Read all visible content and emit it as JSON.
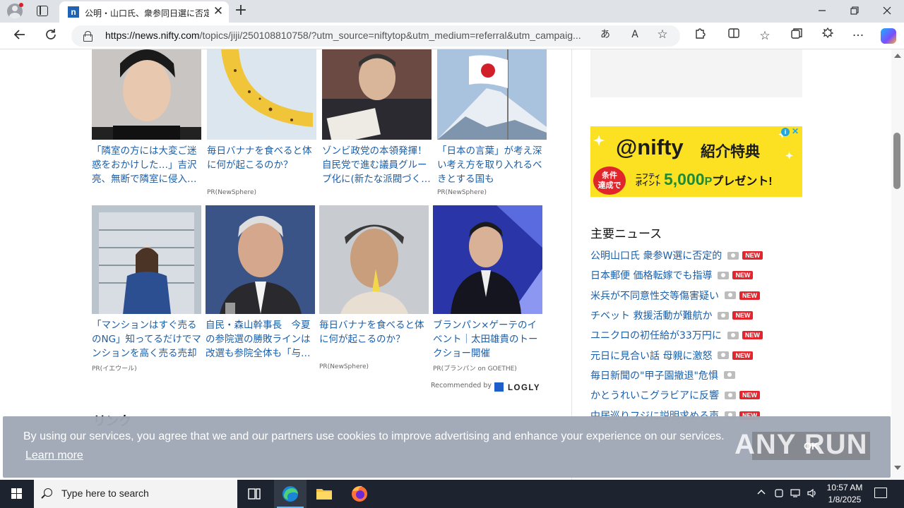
{
  "browser": {
    "tab_title": "公明・山口氏、衆参同日選に否定的",
    "favicon_letter": "n",
    "url_host": "https://news.nifty.com",
    "url_path": "/topics/jiji/250108810758/?utm_source=niftytop&utm_medium=referral&utm_campaig...",
    "new_tab_symbol": "+",
    "close_symbol": "✕"
  },
  "articles": [
    {
      "title": "「隣室の方には大変ご迷惑をおかけした…」吉沢亮、無断で隣室に侵入…",
      "source": ""
    },
    {
      "title": "毎日バナナを食べると体に何が起こるのか？",
      "source": "PR(NewSphere)"
    },
    {
      "title": "ゾンビ政党の本領発揮！自民党で進む議員グループ化に(新たな派閥づく…",
      "source": ""
    },
    {
      "title": "「日本の言葉」が考え深い考え方を取り入れるべきとする国も",
      "source": "PR(NewSphere)"
    },
    {
      "title": "「マンションはすぐ売るのNG」知ってるだけでマンションを高く売る売却術」",
      "source": "PR(イエウール)"
    },
    {
      "title": "自民・森山幹事長　今夏の参院選の勝敗ラインは改選も参院全体も「与…",
      "source": ""
    },
    {
      "title": "毎日バナナを食べると体に何が起こるのか？",
      "source": "PR(NewSphere)"
    },
    {
      "title": "ブランパン×ゲーテのイベント｜太田雄貴のトークショー開催",
      "source": "PR(ブランパン on GOETHE)"
    }
  ],
  "recommended_by": "Recommended by",
  "logly": "LOGLY",
  "section_heading": "リンク",
  "banner": {
    "brand": "@nifty",
    "subtitle": "紹介特典",
    "badge": "条件\n達成で",
    "point_label": "ニフティポイント",
    "point_amount": "5,000",
    "point_unit": "P",
    "point_suffix": "プレゼント!",
    "info": "i",
    "close": "✕"
  },
  "sidebar": {
    "heading": "主要ニュース",
    "news": [
      {
        "text": "公明山口氏 衆参W選に否定的",
        "badge": "NEW"
      },
      {
        "text": "日本郵便 価格転嫁でも指導",
        "badge": "NEW"
      },
      {
        "text": "米兵が不同意性交等傷害疑い",
        "badge": "NEW"
      },
      {
        "text": "チベット 救援活動が難航か",
        "badge": "NEW"
      },
      {
        "text": "ユニクロの初任給が33万円に",
        "badge": "NEW"
      },
      {
        "text": "元日に見合い話 母親に激怒",
        "badge": "NEW"
      },
      {
        "text": "毎日新聞の\"甲子園撤退\"危惧",
        "badge": ""
      },
      {
        "text": "かとうれいこグラビアに反響",
        "badge": "NEW"
      },
      {
        "text": "中居巡りフジに説明求める声",
        "badge": "NEW"
      }
    ]
  },
  "cookie": {
    "text": "By using our services, you agree that we and our partners use cookies to improve advertising and enhance your experience on our services.",
    "learn_more": "Learn more",
    "ok": "OK"
  },
  "watermark": "ANY RUN",
  "taskbar": {
    "search_placeholder": "Type here to search",
    "time": "10:57 AM",
    "date": "1/8/2025"
  }
}
